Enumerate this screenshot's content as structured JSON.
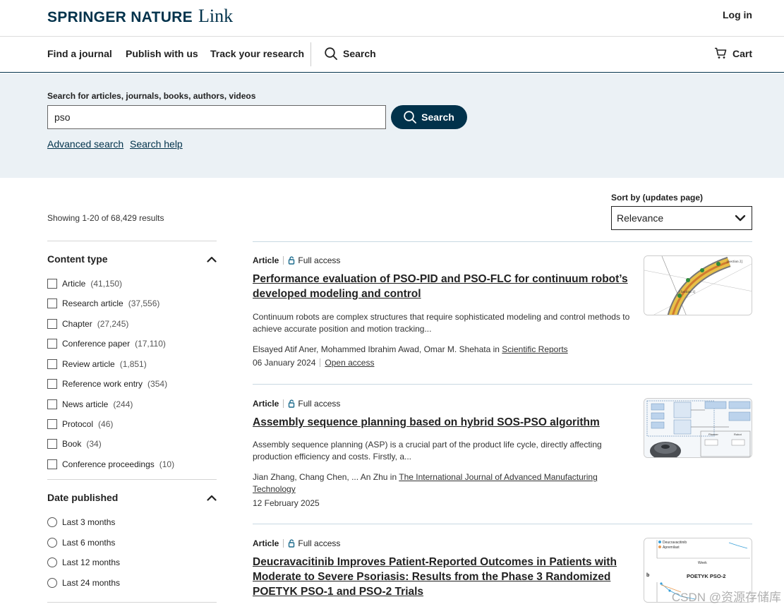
{
  "header": {
    "logo_main": "SPRINGER NATURE",
    "logo_link": "Link",
    "login": "Log in",
    "nav": [
      "Find a journal",
      "Publish with us",
      "Track your research"
    ],
    "search": "Search",
    "cart": "Cart"
  },
  "search": {
    "label": "Search for articles, journals, books, authors, videos",
    "value": "pso",
    "button": "Search",
    "advanced": "Advanced search",
    "help": "Search help"
  },
  "results_meta": {
    "showing": "Showing 1-20 of 68,429 results",
    "sort_label": "Sort by (updates page)",
    "sort_value": "Relevance"
  },
  "filters": {
    "content_type": {
      "title": "Content type",
      "options": [
        {
          "label": "Article",
          "count": "(41,150)"
        },
        {
          "label": "Research article",
          "count": "(37,556)"
        },
        {
          "label": "Chapter",
          "count": "(27,245)"
        },
        {
          "label": "Conference paper",
          "count": "(17,110)"
        },
        {
          "label": "Review article",
          "count": "(1,851)"
        },
        {
          "label": "Reference work entry",
          "count": "(354)"
        },
        {
          "label": "News article",
          "count": "(244)"
        },
        {
          "label": "Protocol",
          "count": "(46)"
        },
        {
          "label": "Book",
          "count": "(34)"
        },
        {
          "label": "Conference proceedings",
          "count": "(10)"
        }
      ]
    },
    "date_published": {
      "title": "Date published",
      "options": [
        "Last 3 months",
        "Last 6 months",
        "Last 12 months",
        "Last 24 months"
      ]
    }
  },
  "results": [
    {
      "type": "Article",
      "access": "Full access",
      "title_lines": [
        "Performance evaluation of PSO-PID and PSO-FLC for continuum robot’s",
        "developed modeling and control"
      ],
      "snippet_lines": [
        "Continuum robots are complex structures that require sophisticated modeling and control methods to",
        "achieve accurate position and motion tracking..."
      ],
      "authors": "Elsayed Atif Aner, Mohammed Ibrahim Awad, Omar M. Shehata in ",
      "journal": "Scientific Reports",
      "date": "06 January 2024",
      "open_access": "Open access"
    },
    {
      "type": "Article",
      "access": "Full access",
      "title_lines": [
        "Assembly sequence planning based on hybrid SOS-PSO algorithm"
      ],
      "snippet_lines": [
        "Assembly sequence planning (ASP) is a crucial part of the product life cycle, directly affecting",
        "production efficiency and costs. Firstly, a..."
      ],
      "authors": "Jian Zhang, Chang Chen, ... An Zhu in ",
      "journal_lines": [
        "The International Journal of Advanced Manufacturing",
        "Technology"
      ],
      "date": "12 February 2025"
    },
    {
      "type": "Article",
      "access": "Full access",
      "title_lines": [
        "Deucravacitinib Improves Patient-Reported Outcomes in Patients with",
        "Moderate to Severe Psoriasis: Results from the Phase 3 Randomized",
        "POETYK PSO-1 and PSO-2 Trials"
      ]
    }
  ],
  "thumbnails": {
    "t1_labels": [
      "[Section 2]",
      "[Section 1]"
    ],
    "t2_labels": [
      "Planner",
      "Robot"
    ],
    "t3_legend": [
      "Deucravacitinib",
      "Apremilast"
    ],
    "t3_title": "POETYK PSO-2",
    "t3_axis": "Week",
    "t3_marker": "b"
  },
  "watermark": "CSDN @资源存储库"
}
